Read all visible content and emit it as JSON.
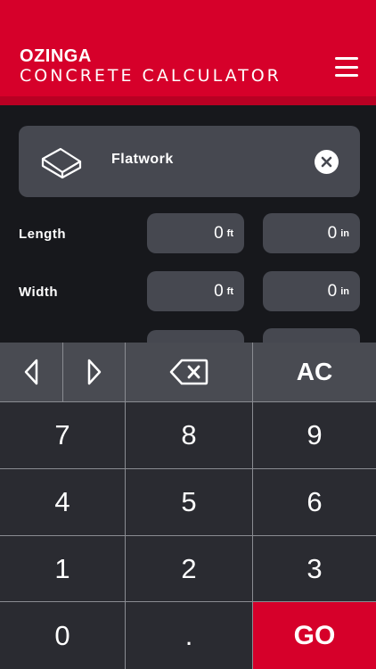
{
  "header": {
    "brand": "OZINGA",
    "subtitle": "CONCRETE CALCULATOR",
    "menu_icon": "hamburger-menu-icon"
  },
  "colors": {
    "brand_red": "#d6002a",
    "background": "#17181c",
    "field_bg": "#464850",
    "key_bg": "#2a2b31",
    "function_key_bg": "#494b52"
  },
  "project_type": {
    "label": "Flatwork",
    "icon": "concrete-slab-icon",
    "clear_icon": "close-icon"
  },
  "dimensions": [
    {
      "label": "Length",
      "feet": "0",
      "feet_unit": "ft",
      "inches": "0",
      "inches_unit": "in"
    },
    {
      "label": "Width",
      "feet": "0",
      "feet_unit": "ft",
      "inches": "0",
      "inches_unit": "in"
    }
  ],
  "keypad": {
    "left_arrow": "left-arrow-icon",
    "right_arrow": "right-arrow-icon",
    "backspace": "backspace-icon",
    "clear": "AC",
    "digits": [
      "7",
      "8",
      "9",
      "4",
      "5",
      "6",
      "1",
      "2",
      "3"
    ],
    "zero": "0",
    "decimal": ".",
    "go": "GO"
  }
}
